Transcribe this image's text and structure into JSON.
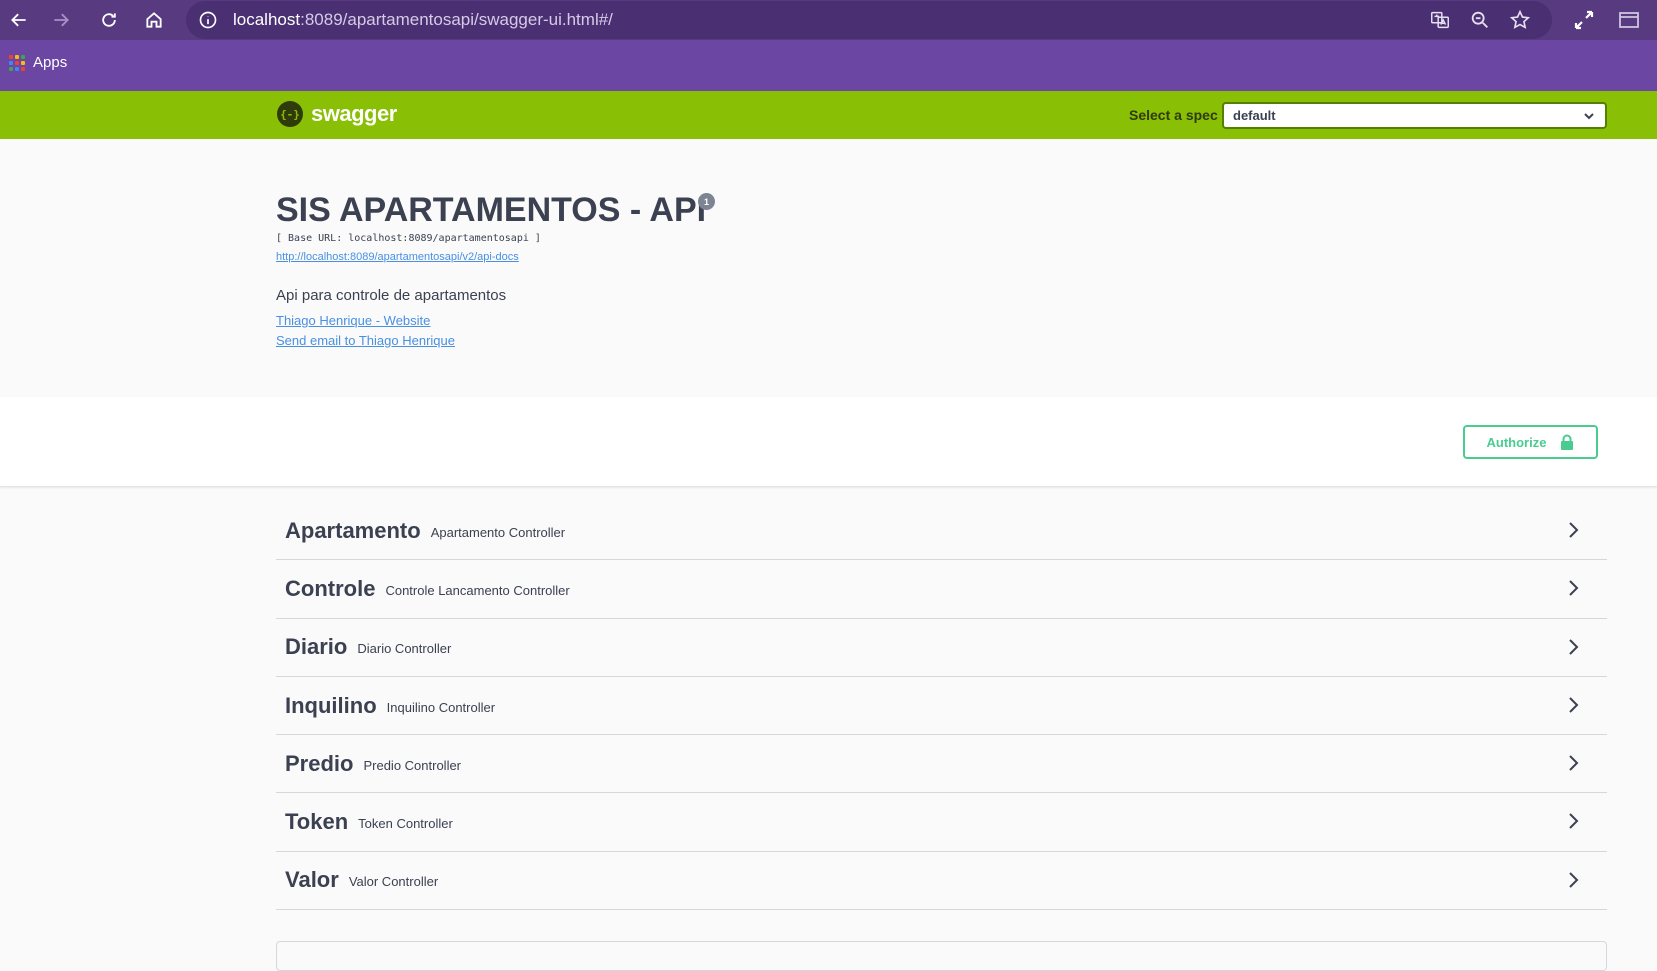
{
  "browser": {
    "url_host": "localhost",
    "url_rest": ":8089/apartamentosapi/swagger-ui.html#/",
    "bookmarks": {
      "apps_label": "Apps"
    }
  },
  "topbar": {
    "logo_text": "swagger",
    "logo_mark": "{-}",
    "spec_label": "Select a spec",
    "spec_value": "default"
  },
  "info": {
    "title": "SIS APARTAMENTOS - API",
    "version": "1",
    "base_url": "[ Base URL: localhost:8089/apartamentosapi ]",
    "docs_link": "http://localhost:8089/apartamentosapi/v2/api-docs",
    "description": "Api para controle de apartamentos",
    "contact_website": "Thiago Henrique - Website",
    "contact_email": "Send email to Thiago Henrique"
  },
  "scheme": {
    "authorize_label": "Authorize"
  },
  "tags": [
    {
      "name": "Apartamento",
      "description": "Apartamento Controller"
    },
    {
      "name": "Controle",
      "description": "Controle Lancamento Controller"
    },
    {
      "name": "Diario",
      "description": "Diario Controller"
    },
    {
      "name": "Inquilino",
      "description": "Inquilino Controller"
    },
    {
      "name": "Predio",
      "description": "Predio Controller"
    },
    {
      "name": "Token",
      "description": "Token Controller"
    },
    {
      "name": "Valor",
      "description": "Valor Controller"
    }
  ],
  "colors": {
    "topbar": "#89bf04",
    "chrome": "#573a80",
    "bookmarks_bar": "#6b46a3",
    "authorize": "#49cc90",
    "link": "#4990e2",
    "text": "#3b4151"
  }
}
